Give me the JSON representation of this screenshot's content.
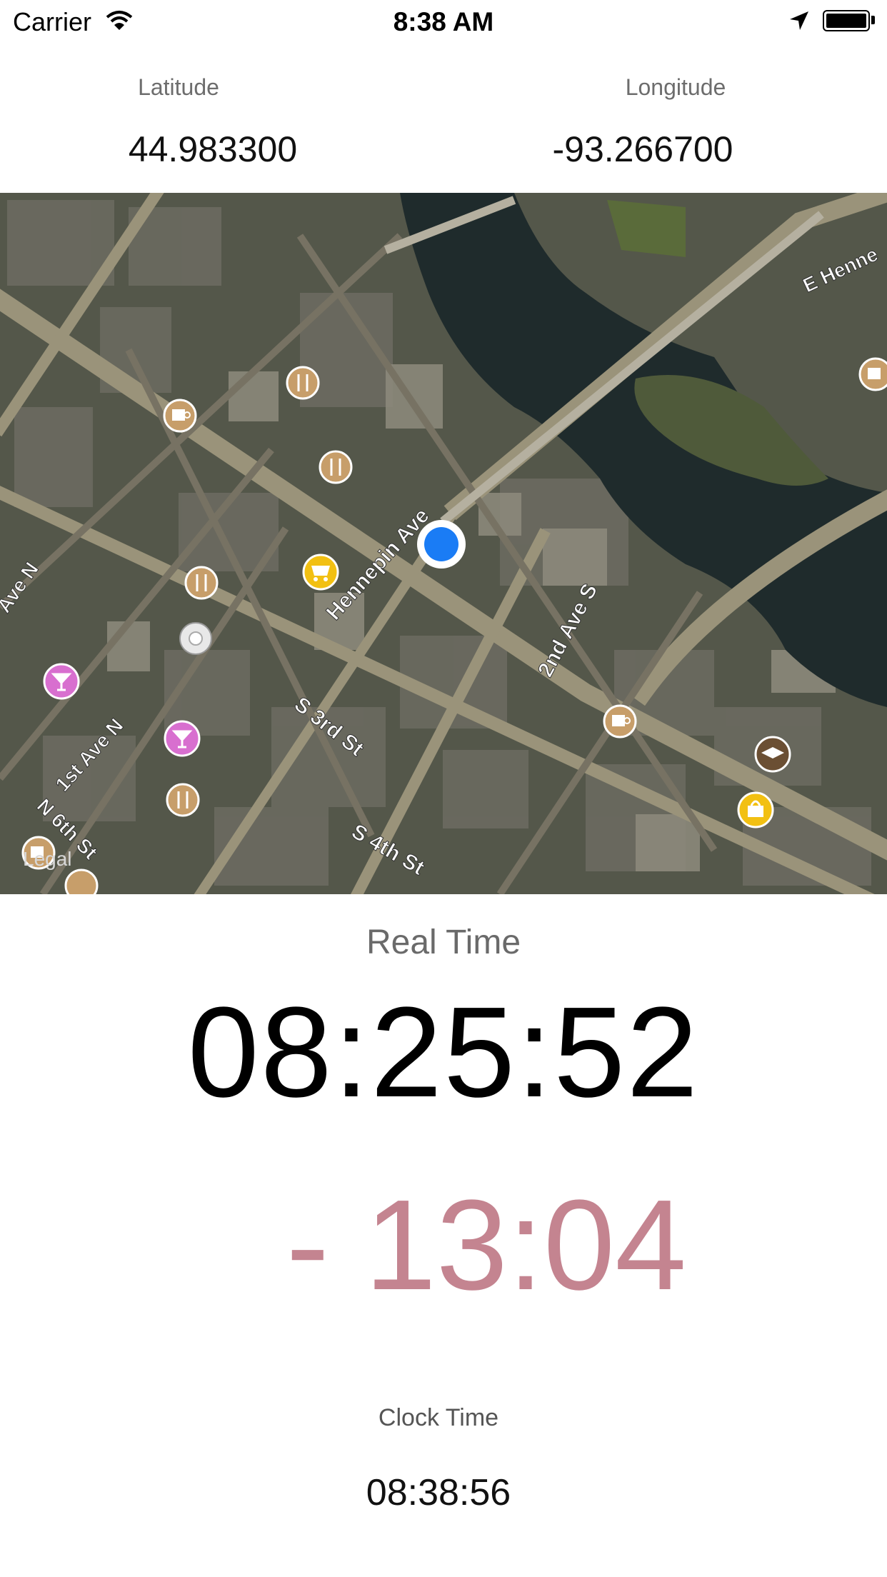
{
  "status_bar": {
    "carrier": "Carrier",
    "time": "8:38 AM",
    "icons": [
      "wifi-icon",
      "location-arrow-icon",
      "battery-icon"
    ]
  },
  "coordinates": {
    "latitude_label": "Latitude",
    "latitude_value": "44.983300",
    "longitude_label": "Longitude",
    "longitude_value": "-93.266700"
  },
  "map": {
    "street_labels": {
      "hennepin_ave": "Hennepin Ave",
      "second_ave_s": "2nd Ave S",
      "third_st": "S 3rd St",
      "fourth_st": "S 4th St",
      "first_ave_n": "1st Ave N",
      "sixth_st": "N 6th St",
      "ave_n": "Ave N",
      "e_hennepin": "E Henne"
    },
    "legal": "Legal",
    "pins": [
      "coffee-icon",
      "restaurant-icon",
      "shopping-cart-icon",
      "cocktail-icon",
      "school-icon",
      "bag-icon"
    ],
    "colors": {
      "user_location": "#1a7cf5",
      "water": "#1d2a2c"
    }
  },
  "real_time": {
    "label": "Real Time",
    "value": "08:25:52"
  },
  "offset": {
    "value": "- 13:04",
    "color": "#c48490"
  },
  "clock_time": {
    "label": "Clock Time",
    "value": "08:38:56"
  }
}
